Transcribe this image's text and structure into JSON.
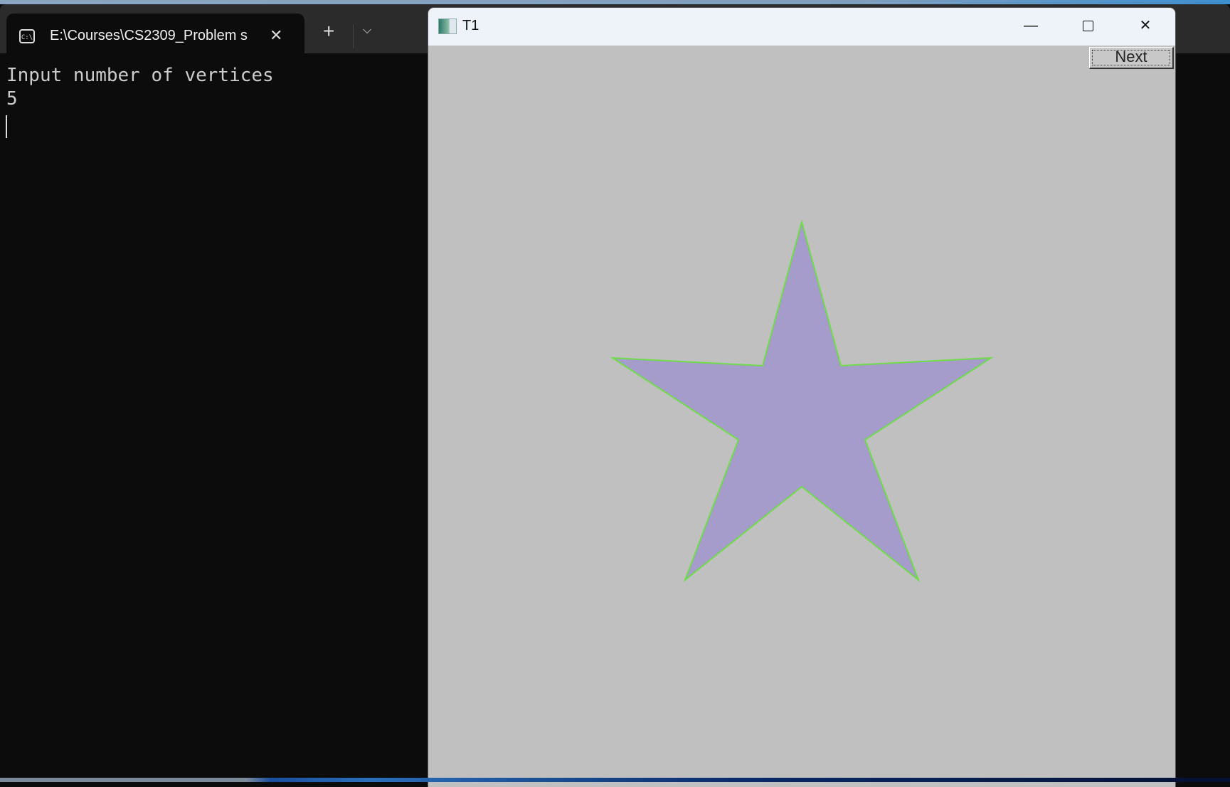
{
  "terminal": {
    "tab_title": "E:\\Courses\\CS2309_Problem s",
    "tab_icon": "cmd-icon",
    "new_tab_label": "+",
    "output_lines": [
      "Input number of vertices",
      "5"
    ]
  },
  "window": {
    "title": "T1",
    "next_label": "Next",
    "shape": {
      "type": "star",
      "vertices": 5,
      "fill": "#a59ccb",
      "stroke": "#6fdc4a"
    },
    "background": "#c0c0c0"
  }
}
